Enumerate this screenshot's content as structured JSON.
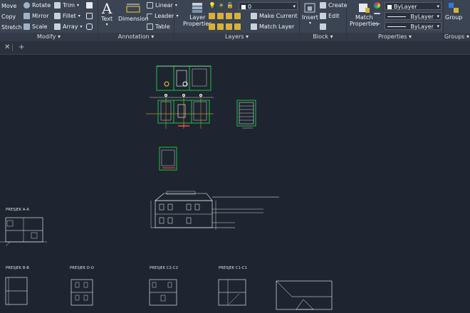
{
  "ribbon": {
    "modify": {
      "title": "Modify",
      "move": "Move",
      "rotate": "Rotate",
      "trim": "Trim",
      "copy": "Copy",
      "mirror": "Mirror",
      "fillet": "Fillet",
      "stretch": "Stretch",
      "scale": "Scale",
      "array": "Array"
    },
    "annotation": {
      "title": "Annotation",
      "text": "Text",
      "dimension": "Dimension",
      "linear": "Linear",
      "leader": "Leader",
      "table": "Table"
    },
    "layers": {
      "title": "Layers",
      "layer_properties_1": "Layer",
      "layer_properties_2": "Properties",
      "current_layer": "0",
      "make_current": "Make Current",
      "match_layer": "Match Layer"
    },
    "block": {
      "title": "Block",
      "insert": "Insert",
      "create": "Create",
      "edit": "Edit"
    },
    "properties": {
      "title": "Properties",
      "match_1": "Match",
      "match_2": "Properties",
      "color_value": "ByLayer",
      "linetype_value": "ByLayer",
      "lineweight_value": "ByLayer"
    },
    "groups": {
      "title": "Groups",
      "group": "Group"
    }
  },
  "drawing": {
    "labels": {
      "presjek_aa": "PRESJEK A-A",
      "presjek_bb": "PRESJEK B-B",
      "presjek_dd": "PRESJEK D-D",
      "presjek_c2": "PRESJEK C2-C2",
      "presjek_c1": "PRESJEK C1-C1"
    }
  },
  "colors": {
    "ribbon_bg": "#3b4453",
    "canvas_bg": "#1e2530",
    "green": "#19c23b",
    "red": "#e0303a",
    "yellow": "#f0d030"
  }
}
